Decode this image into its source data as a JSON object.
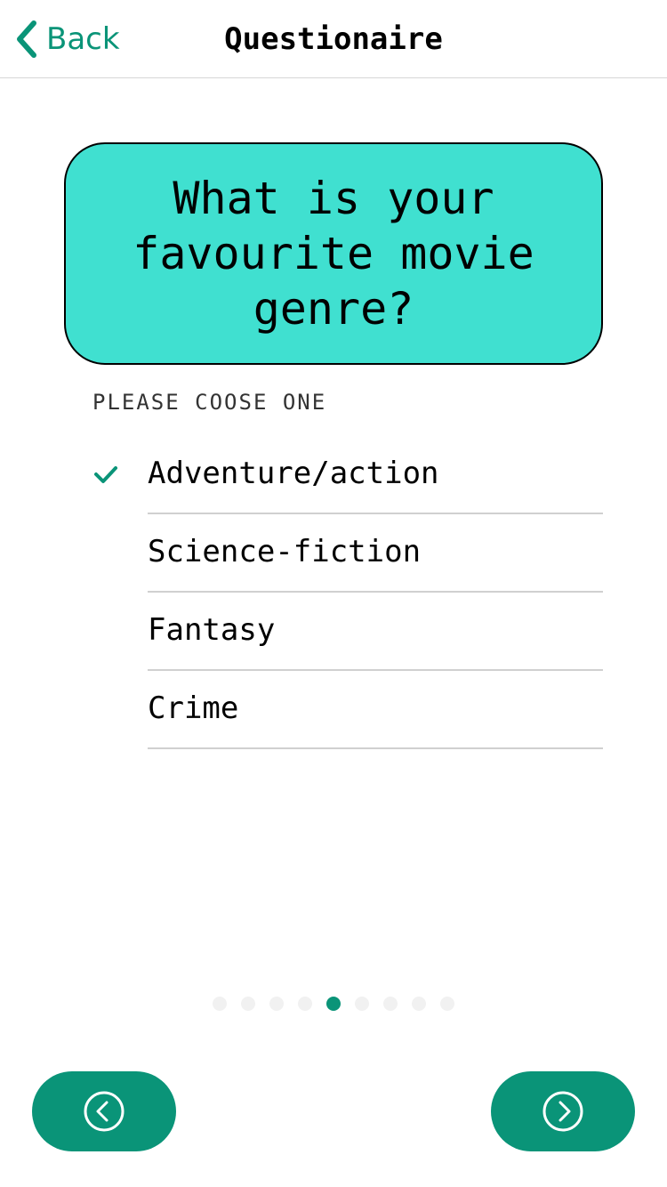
{
  "header": {
    "back_label": "Back",
    "title": "Questionaire"
  },
  "question": {
    "text": "What is your favourite movie genre?"
  },
  "instruction": "PLEASE COOSE ONE",
  "options": [
    {
      "label": "Adventure/action",
      "selected": true
    },
    {
      "label": "Science-fiction",
      "selected": false
    },
    {
      "label": "Fantasy",
      "selected": false
    },
    {
      "label": "Crime",
      "selected": false
    }
  ],
  "pagination": {
    "total": 9,
    "current": 5
  },
  "nav": {
    "prev_icon": "chevron-left-circle-icon",
    "next_icon": "chevron-right-circle-icon"
  },
  "colors": {
    "accent": "#0a9478",
    "card": "#40e0d0",
    "dot_inactive": "#f1f1f1"
  }
}
